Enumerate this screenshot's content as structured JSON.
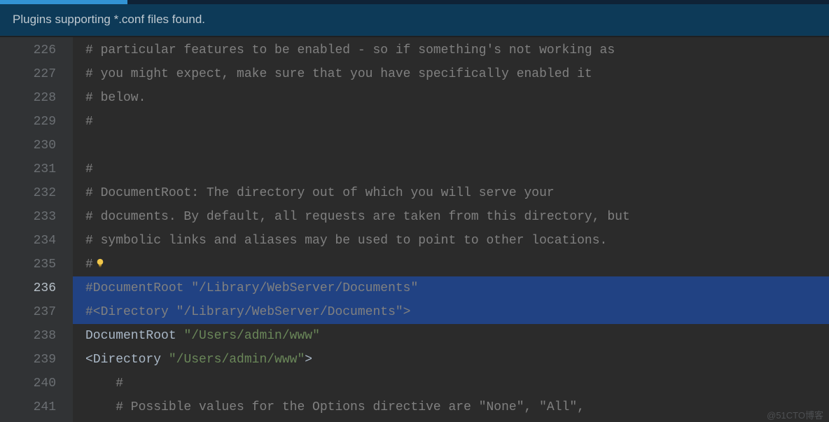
{
  "notification": {
    "text": "Plugins supporting *.conf files found."
  },
  "editor": {
    "first_line_number": 226,
    "current_line_index": 10,
    "selected_line_indices": [
      10,
      11
    ],
    "lines": [
      {
        "indent": 0,
        "type": "comment",
        "text": "# particular features to be enabled - so if something's not working as"
      },
      {
        "indent": 0,
        "type": "comment",
        "text": "# you might expect, make sure that you have specifically enabled it"
      },
      {
        "indent": 0,
        "type": "comment",
        "text": "# below."
      },
      {
        "indent": 0,
        "type": "comment",
        "text": "#"
      },
      {
        "indent": 0,
        "type": "blank",
        "text": ""
      },
      {
        "indent": 0,
        "type": "comment",
        "text": "#"
      },
      {
        "indent": 0,
        "type": "comment",
        "text": "# DocumentRoot: The directory out of which you will serve your"
      },
      {
        "indent": 0,
        "type": "comment",
        "text": "# documents. By default, all requests are taken from this directory, but"
      },
      {
        "indent": 0,
        "type": "comment",
        "text": "# symbolic links and aliases may be used to point to other locations."
      },
      {
        "indent": 0,
        "type": "comment",
        "text": "#",
        "bulb": true
      },
      {
        "indent": 0,
        "type": "comment",
        "text": "#DocumentRoot \"/Library/WebServer/Documents\""
      },
      {
        "indent": 0,
        "type": "comment",
        "text": "#<Directory \"/Library/WebServer/Documents\">"
      },
      {
        "indent": 0,
        "type": "directive",
        "key": "DocumentRoot",
        "value": "\"/Users/admin/www\""
      },
      {
        "indent": 0,
        "type": "tagopen",
        "key": "Directory",
        "value": "\"/Users/admin/www\""
      },
      {
        "indent": 1,
        "type": "comment",
        "text": "#"
      },
      {
        "indent": 1,
        "type": "comment",
        "text": "# Possible values for the Options directive are \"None\", \"All\","
      }
    ]
  },
  "watermark": "@51CTO博客"
}
